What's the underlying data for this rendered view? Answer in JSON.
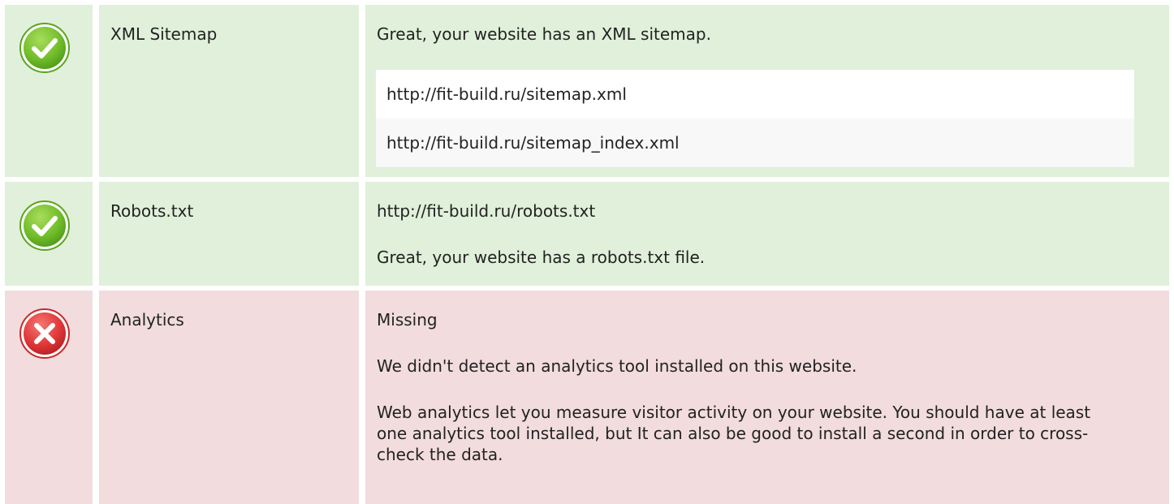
{
  "checks": {
    "xml_sitemap": {
      "status": "passed",
      "status_icon": "check-circle-icon",
      "label": "XML Sitemap",
      "message": "Great, your website has an XML sitemap.",
      "urls": [
        "http://fit-build.ru/sitemap.xml",
        "http://fit-build.ru/sitemap_index.xml"
      ]
    },
    "robots_txt": {
      "status": "passed",
      "status_icon": "check-circle-icon",
      "label": "Robots.txt",
      "url": "http://fit-build.ru/robots.txt",
      "message": "Great, your website has a robots.txt file."
    },
    "analytics": {
      "status": "failed",
      "status_icon": "error-circle-icon",
      "label": "Analytics",
      "value": "Missing",
      "message": "We didn't detect an analytics tool installed on this website.",
      "advice": "Web analytics let you measure visitor activity on your website. You should have at least one analytics tool installed, but It can also be good to install a second in order to cross-check the data."
    }
  },
  "colors": {
    "pass_background": "#e0f0da",
    "fail_background": "#f2dcdd",
    "pass_icon": "#6cba2a",
    "fail_icon": "#e2393a"
  }
}
